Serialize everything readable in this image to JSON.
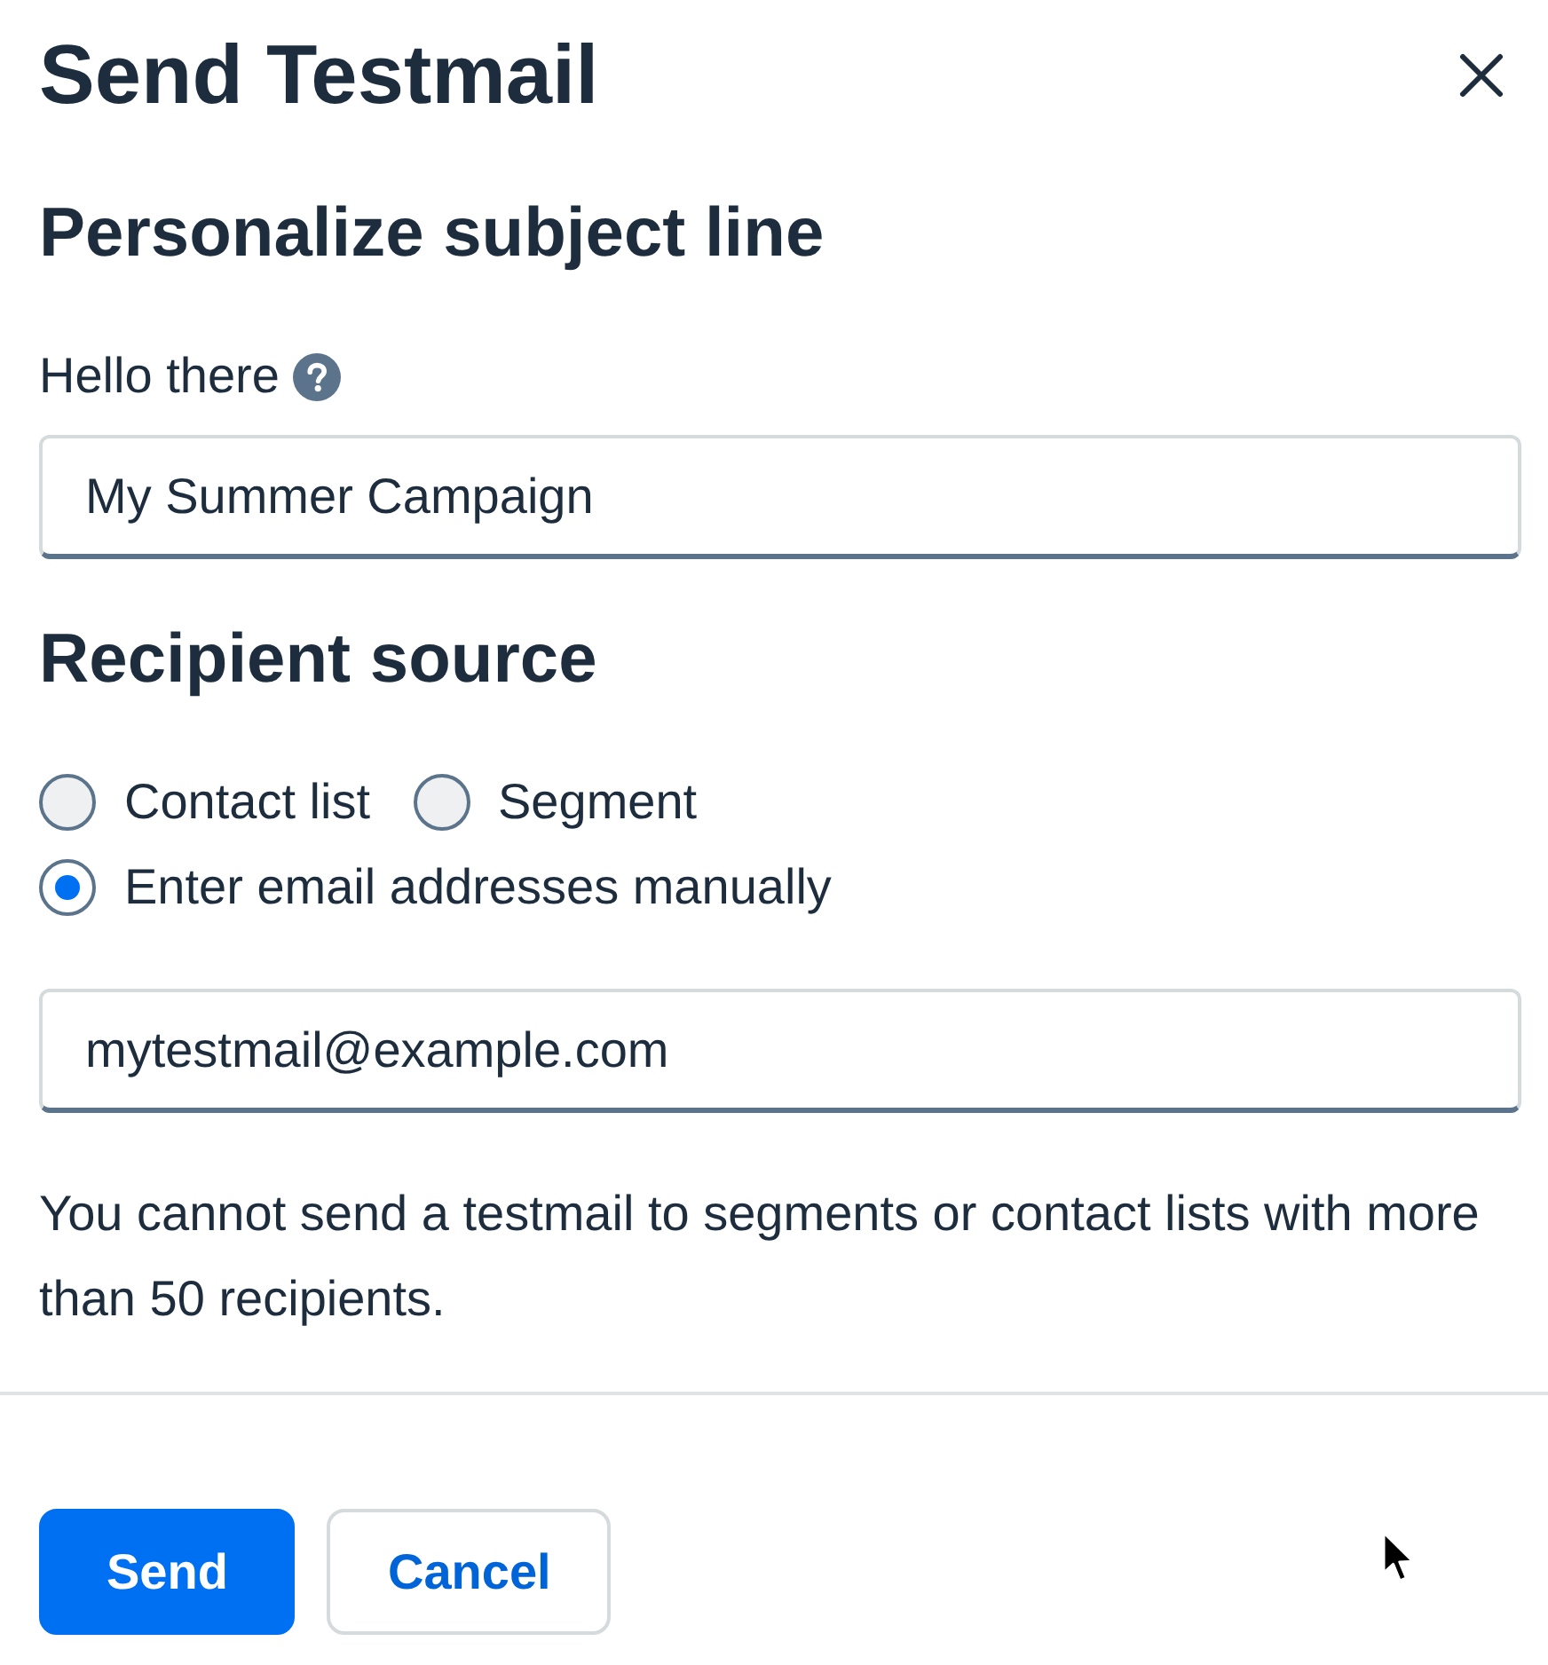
{
  "dialog": {
    "title": "Send Testmail"
  },
  "subject_section": {
    "heading": "Personalize subject line",
    "field": {
      "label": "Hello there",
      "value": "My Summer Campaign"
    }
  },
  "recipient_section": {
    "heading": "Recipient source",
    "options": [
      {
        "label": "Contact list",
        "selected": false
      },
      {
        "label": "Segment",
        "selected": false
      },
      {
        "label": "Enter email addresses manually",
        "selected": true
      }
    ],
    "email_field": {
      "value": "mytestmail@example.com"
    },
    "note": "You cannot send a testmail to segments or contact lists with more than 50 recipients."
  },
  "buttons": [
    {
      "label": "Send",
      "kind": "primary"
    },
    {
      "label": "Cancel",
      "kind": "secondary"
    }
  ]
}
